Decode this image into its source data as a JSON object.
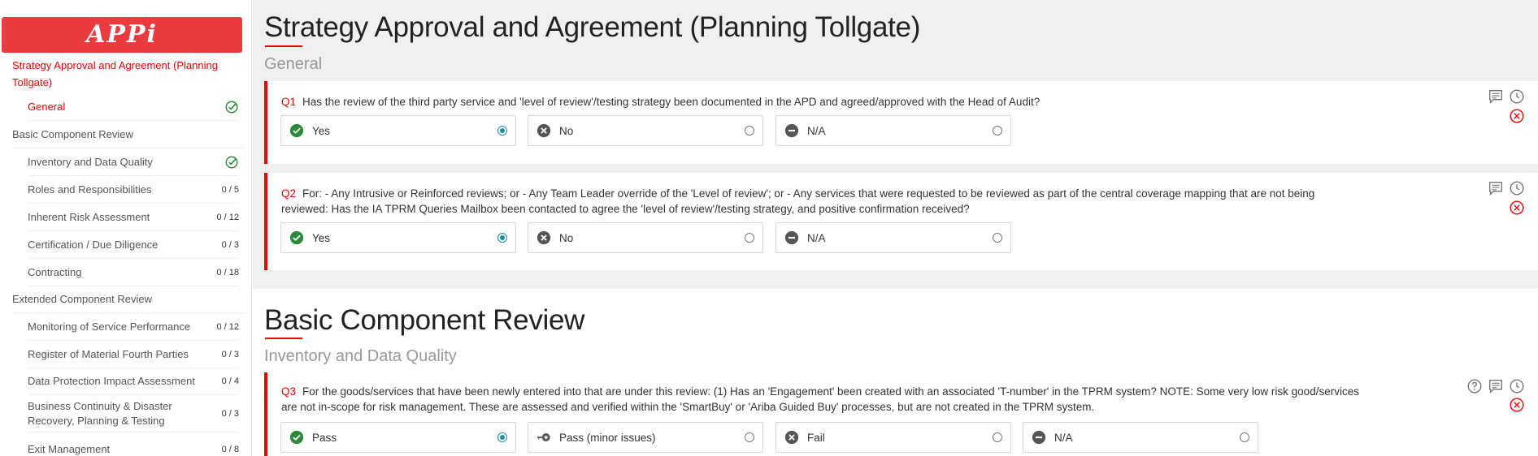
{
  "sidebar": {
    "logo": "APPi",
    "title": "Strategy Approval and Agreement (Planning Tollgate)",
    "items": [
      {
        "label": "General",
        "count": "",
        "done": true,
        "level": "sub",
        "active": true
      },
      {
        "label": "Basic Component Review",
        "count": "",
        "done": false,
        "level": "top",
        "active": false
      },
      {
        "label": "Inventory and Data Quality",
        "count": "",
        "done": true,
        "level": "sub",
        "active": false
      },
      {
        "label": "Roles and Responsibilities",
        "count": "0 / 5",
        "done": false,
        "level": "sub",
        "active": false
      },
      {
        "label": "Inherent Risk Assessment",
        "count": "0 / 12",
        "done": false,
        "level": "sub",
        "active": false
      },
      {
        "label": "Certification / Due Diligence",
        "count": "0 / 3",
        "done": false,
        "level": "sub",
        "active": false
      },
      {
        "label": "Contracting",
        "count": "0 / 18",
        "done": false,
        "level": "sub",
        "active": false
      },
      {
        "label": "Extended Component Review",
        "count": "",
        "done": false,
        "level": "top",
        "active": false
      },
      {
        "label": "Monitoring of Service Performance",
        "count": "0 / 12",
        "done": false,
        "level": "sub",
        "active": false
      },
      {
        "label": "Register of Material Fourth Parties",
        "count": "0 / 3",
        "done": false,
        "level": "sub",
        "active": false
      },
      {
        "label": "Data Protection Impact Assessment",
        "count": "0 / 4",
        "done": false,
        "level": "sub",
        "active": false
      },
      {
        "label": "Business Continuity & Disaster Recovery, Planning & Testing",
        "count": "0 / 3",
        "done": false,
        "level": "sub",
        "active": false
      },
      {
        "label": "Exit Management",
        "count": "0 / 8",
        "done": false,
        "level": "sub",
        "active": false
      }
    ]
  },
  "sections": [
    {
      "title": "Strategy Approval and Agreement (Planning Tollgate)",
      "subtitle": "General"
    },
    {
      "title": "Basic Component Review",
      "subtitle": "Inventory and Data Quality"
    }
  ],
  "questions": [
    {
      "num": "Q1",
      "text": "Has the review of the third party service and 'level of review'/testing strategy been documented in the APD and agreed/approved with the Head of Audit?",
      "options": [
        {
          "label": "Yes",
          "icon": "check-circle-icon",
          "selected": true
        },
        {
          "label": "No",
          "icon": "x-circle-icon",
          "selected": false
        },
        {
          "label": "N/A",
          "icon": "minus-circle-icon",
          "selected": false
        }
      ]
    },
    {
      "num": "Q2",
      "text": "For: - Any Intrusive or Reinforced reviews; or - Any Team Leader override of the 'Level of review'; or - Any services that were requested to be reviewed as part of the central coverage mapping that are not being reviewed: Has the IA TPRM Queries Mailbox been contacted to agree the 'level of review'/testing strategy, and positive confirmation received?",
      "options": [
        {
          "label": "Yes",
          "icon": "check-circle-icon",
          "selected": true
        },
        {
          "label": "No",
          "icon": "x-circle-icon",
          "selected": false
        },
        {
          "label": "N/A",
          "icon": "minus-circle-icon",
          "selected": false
        }
      ]
    },
    {
      "num": "Q3",
      "text": "For the goods/services that have been newly entered into that are under this review: (1) Has an 'Engagement' been created with an associated 'T-number' in the TPRM system? NOTE: Some very low risk good/services are not in-scope for risk management. These are assessed and verified within the 'SmartBuy' or 'Ariba Guided Buy' processes, but are not created in the TPRM system.",
      "options": [
        {
          "label": "Pass",
          "icon": "check-circle-icon",
          "selected": true
        },
        {
          "label": "Pass (minor issues)",
          "icon": "key-plus-icon",
          "selected": false
        },
        {
          "label": "Fail",
          "icon": "x-circle-icon",
          "selected": false
        },
        {
          "label": "N/A",
          "icon": "minus-circle-icon",
          "selected": false
        }
      ]
    }
  ],
  "colors": {
    "accent": "#ee0000",
    "brand": "#ec3b3e",
    "radio": "#1a8fa0",
    "check": "#2a8a3a"
  }
}
